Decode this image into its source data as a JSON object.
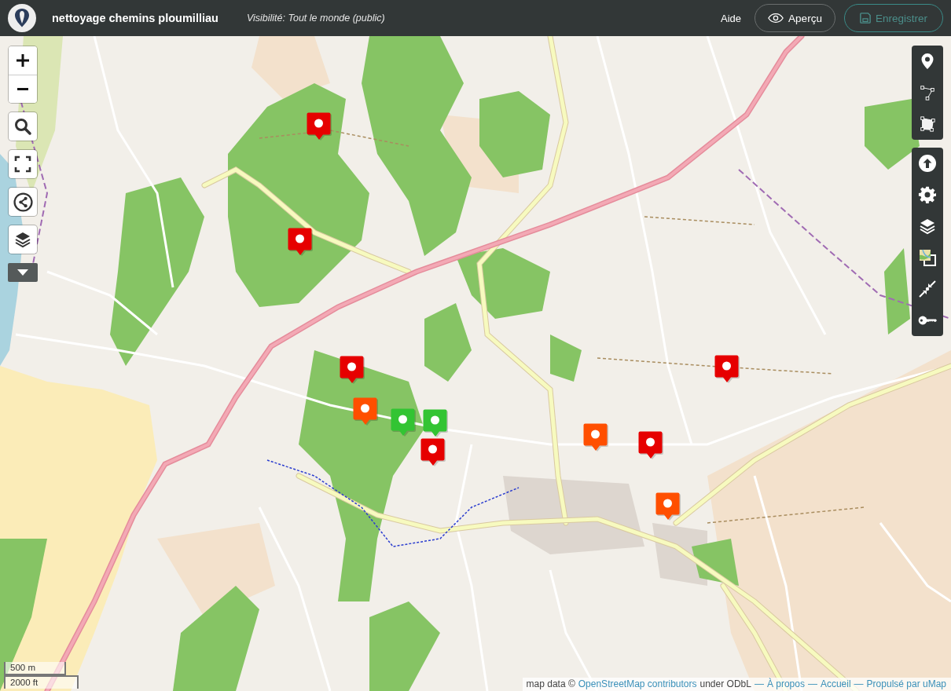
{
  "header": {
    "title": "nettoyage chemins ploumilliau",
    "visibility": "Visibilité: Tout le monde (public)",
    "help": "Aide",
    "preview": "Aperçu",
    "save": {
      "label": "Enregistrer",
      "disabled": true
    }
  },
  "markers": [
    {
      "color": "#e60000"
    },
    {
      "color": "#e60000"
    },
    {
      "color": "#e60000"
    },
    {
      "color": "#ff4f00"
    },
    {
      "color": "#33c433"
    },
    {
      "color": "#33c433"
    },
    {
      "color": "#e60000"
    },
    {
      "color": "#ff4f00"
    },
    {
      "color": "#e60000"
    },
    {
      "color": "#e60000"
    },
    {
      "color": "#ff4f00"
    }
  ],
  "scale": {
    "metric": "500 m",
    "imperial": "2000 ft"
  },
  "attribution": [
    {
      "kind": "text",
      "text": "map data ©"
    },
    {
      "kind": "link",
      "text": "OpenStreetMap contributors"
    },
    {
      "kind": "text",
      "text": "under ODbL"
    },
    {
      "kind": "separator",
      "text": "—"
    },
    {
      "kind": "link",
      "text": "À propos"
    },
    {
      "kind": "separator",
      "text": "—"
    },
    {
      "kind": "link",
      "text": "Accueil"
    },
    {
      "kind": "separator",
      "text": "—"
    },
    {
      "kind": "link",
      "text": "Propulsé par uMap"
    }
  ]
}
